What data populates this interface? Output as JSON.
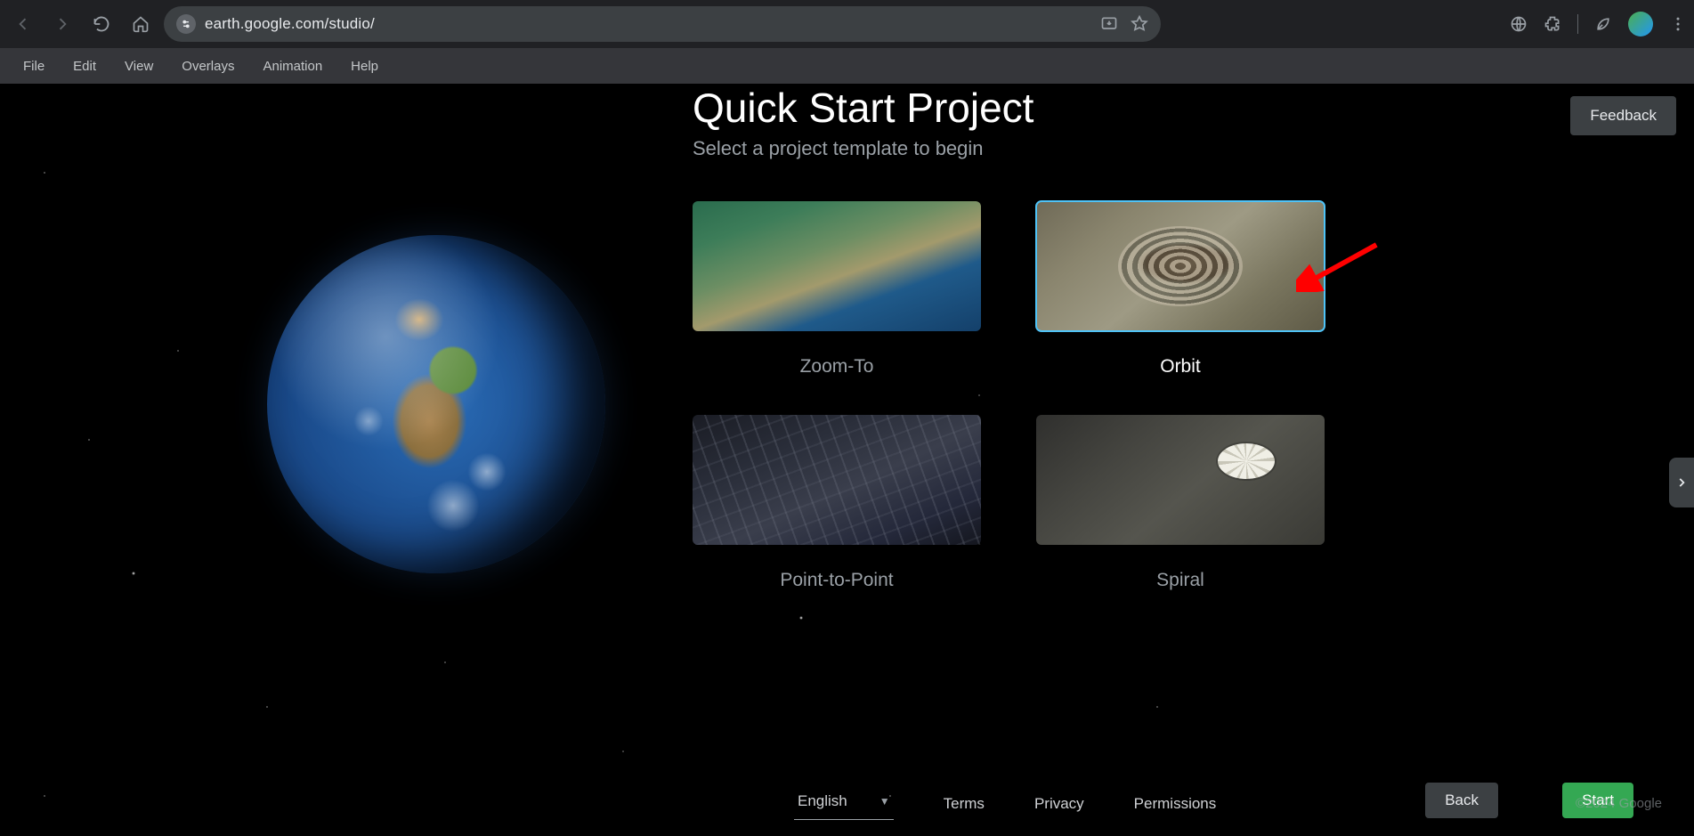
{
  "browser": {
    "url": "earth.google.com/studio/"
  },
  "menu": {
    "items": [
      "File",
      "Edit",
      "View",
      "Overlays",
      "Animation",
      "Help"
    ]
  },
  "panel": {
    "title": "Quick Start Project",
    "subtitle": "Select a project template to begin",
    "feedback_label": "Feedback"
  },
  "templates": [
    {
      "id": "zoom-to",
      "label": "Zoom-To",
      "selected": false
    },
    {
      "id": "orbit",
      "label": "Orbit",
      "selected": true
    },
    {
      "id": "point-to-point",
      "label": "Point-to-Point",
      "selected": false
    },
    {
      "id": "spiral",
      "label": "Spiral",
      "selected": false
    }
  ],
  "footer": {
    "language": "English",
    "links": [
      "Terms",
      "Privacy",
      "Permissions"
    ],
    "back_label": "Back",
    "start_label": "Start",
    "copyright": "©2024 Google"
  }
}
